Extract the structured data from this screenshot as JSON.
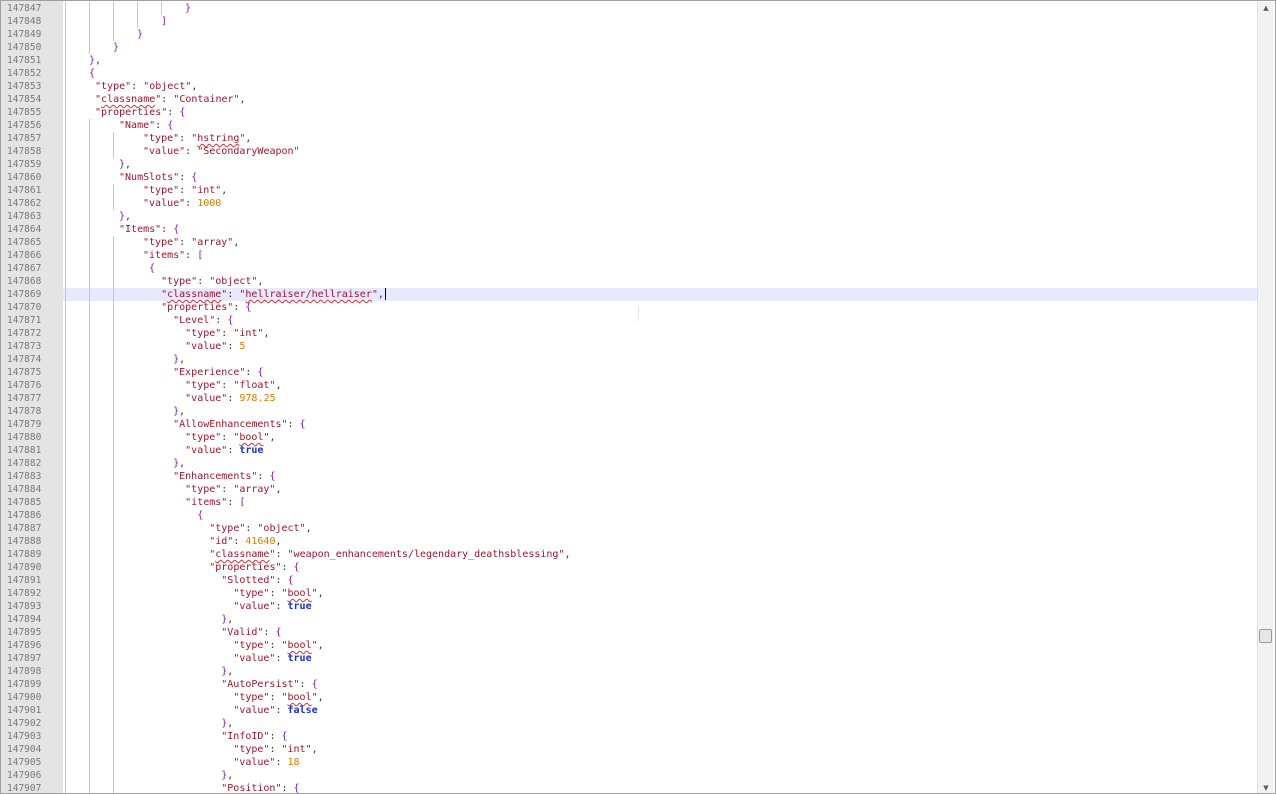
{
  "editor": {
    "caret_line": 147869,
    "lines": [
      {
        "n": "147847",
        "i": 5,
        "t": [
          [
            "}",
            "br"
          ]
        ]
      },
      {
        "n": "147848",
        "i": 4,
        "t": [
          [
            "]",
            "br"
          ]
        ]
      },
      {
        "n": "147849",
        "i": 3,
        "t": [
          [
            "}",
            "br"
          ]
        ]
      },
      {
        "n": "147850",
        "i": 2,
        "t": [
          [
            "}",
            "br"
          ]
        ]
      },
      {
        "n": "147851",
        "i": 1,
        "t": [
          [
            "}",
            "br"
          ],
          [
            ",",
            "p"
          ]
        ]
      },
      {
        "n": "147852",
        "i": 1,
        "t": [
          [
            "{",
            "br"
          ]
        ]
      },
      {
        "n": "147853",
        "i": 1,
        "x": 1,
        "t": [
          [
            "\"type\"",
            "key"
          ],
          [
            ": ",
            "p"
          ],
          [
            "\"object\"",
            "str"
          ],
          [
            ",",
            "p"
          ]
        ]
      },
      {
        "n": "147854",
        "i": 1,
        "x": 1,
        "t": [
          [
            "\"",
            "key"
          ],
          [
            "classname",
            "key",
            "sq"
          ],
          [
            "\"",
            "key"
          ],
          [
            ": ",
            "p"
          ],
          [
            "\"Container\"",
            "str"
          ],
          [
            ",",
            "p"
          ]
        ]
      },
      {
        "n": "147855",
        "i": 1,
        "x": 1,
        "t": [
          [
            "\"properties\"",
            "key"
          ],
          [
            ": ",
            "p"
          ],
          [
            "{",
            "br"
          ]
        ]
      },
      {
        "n": "147856",
        "i": 2,
        "x": 1,
        "t": [
          [
            "\"Name\"",
            "key"
          ],
          [
            ": ",
            "p"
          ],
          [
            "{",
            "br"
          ]
        ]
      },
      {
        "n": "147857",
        "i": 3,
        "x": 1,
        "t": [
          [
            "\"type\"",
            "key"
          ],
          [
            ": ",
            "p"
          ],
          [
            "\"",
            "str"
          ],
          [
            "hstring",
            "str",
            "sq"
          ],
          [
            "\"",
            "str"
          ],
          [
            ",",
            "p"
          ]
        ]
      },
      {
        "n": "147858",
        "i": 3,
        "x": 1,
        "t": [
          [
            "\"value\"",
            "key"
          ],
          [
            ": ",
            "p"
          ],
          [
            "\"SecondaryWeapon\"",
            "str"
          ]
        ]
      },
      {
        "n": "147859",
        "i": 2,
        "x": 1,
        "t": [
          [
            "}",
            "br"
          ],
          [
            ",",
            "p"
          ]
        ]
      },
      {
        "n": "147860",
        "i": 2,
        "x": 1,
        "t": [
          [
            "\"NumSlots\"",
            "key"
          ],
          [
            ": ",
            "p"
          ],
          [
            "{",
            "br"
          ]
        ]
      },
      {
        "n": "147861",
        "i": 3,
        "x": 1,
        "t": [
          [
            "\"type\"",
            "key"
          ],
          [
            ": ",
            "p"
          ],
          [
            "\"int\"",
            "str"
          ],
          [
            ",",
            "p"
          ]
        ]
      },
      {
        "n": "147862",
        "i": 3,
        "x": 1,
        "t": [
          [
            "\"value\"",
            "key"
          ],
          [
            ": ",
            "p"
          ],
          [
            "1000",
            "num"
          ]
        ]
      },
      {
        "n": "147863",
        "i": 2,
        "x": 1,
        "t": [
          [
            "}",
            "br"
          ],
          [
            ",",
            "p"
          ]
        ]
      },
      {
        "n": "147864",
        "i": 2,
        "x": 1,
        "t": [
          [
            "\"Items\"",
            "key"
          ],
          [
            ": ",
            "p"
          ],
          [
            "{",
            "br"
          ]
        ]
      },
      {
        "n": "147865",
        "i": 3,
        "x": 1,
        "t": [
          [
            "\"type\"",
            "key"
          ],
          [
            ": ",
            "p"
          ],
          [
            "\"array\"",
            "str"
          ],
          [
            ",",
            "p"
          ]
        ]
      },
      {
        "n": "147866",
        "i": 3,
        "x": 1,
        "t": [
          [
            "\"items\"",
            "key"
          ],
          [
            ": ",
            "p"
          ],
          [
            "[",
            "br"
          ]
        ]
      },
      {
        "n": "147867",
        "i": 3,
        "x": 2,
        "t": [
          [
            "{",
            "br"
          ]
        ]
      },
      {
        "n": "147868",
        "i": 3,
        "x": 4,
        "t": [
          [
            "\"type\"",
            "key"
          ],
          [
            ": ",
            "p"
          ],
          [
            "\"object\"",
            "str"
          ],
          [
            ",",
            "p"
          ]
        ]
      },
      {
        "n": "147869",
        "i": 3,
        "x": 4,
        "cur": true,
        "t": [
          [
            "\"",
            "key"
          ],
          [
            "classname",
            "key",
            "sq"
          ],
          [
            "\"",
            "key"
          ],
          [
            ": ",
            "p"
          ],
          [
            "\"",
            "str"
          ],
          [
            "hellraiser/hellraiser",
            "str",
            "sq"
          ],
          [
            "\"",
            "str"
          ],
          [
            ",",
            "p"
          ]
        ]
      },
      {
        "n": "147870",
        "i": 3,
        "x": 4,
        "t": [
          [
            "\"properties\"",
            "key"
          ],
          [
            ": ",
            "p"
          ],
          [
            "{",
            "br"
          ]
        ]
      },
      {
        "n": "147871",
        "i": 3,
        "x": 6,
        "t": [
          [
            "\"Level\"",
            "key"
          ],
          [
            ": ",
            "p"
          ],
          [
            "{",
            "br"
          ]
        ]
      },
      {
        "n": "147872",
        "i": 3,
        "x": 8,
        "t": [
          [
            "\"type\"",
            "key"
          ],
          [
            ": ",
            "p"
          ],
          [
            "\"int\"",
            "str"
          ],
          [
            ",",
            "p"
          ]
        ]
      },
      {
        "n": "147873",
        "i": 3,
        "x": 8,
        "t": [
          [
            "\"value\"",
            "key"
          ],
          [
            ": ",
            "p"
          ],
          [
            "5",
            "num"
          ]
        ]
      },
      {
        "n": "147874",
        "i": 3,
        "x": 6,
        "t": [
          [
            "}",
            "br"
          ],
          [
            ",",
            "p"
          ]
        ]
      },
      {
        "n": "147875",
        "i": 3,
        "x": 6,
        "t": [
          [
            "\"Experience\"",
            "key"
          ],
          [
            ": ",
            "p"
          ],
          [
            "{",
            "br"
          ]
        ]
      },
      {
        "n": "147876",
        "i": 3,
        "x": 8,
        "t": [
          [
            "\"type\"",
            "key"
          ],
          [
            ": ",
            "p"
          ],
          [
            "\"float\"",
            "str"
          ],
          [
            ",",
            "p"
          ]
        ]
      },
      {
        "n": "147877",
        "i": 3,
        "x": 8,
        "t": [
          [
            "\"value\"",
            "key"
          ],
          [
            ": ",
            "p"
          ],
          [
            "978.25",
            "num"
          ]
        ]
      },
      {
        "n": "147878",
        "i": 3,
        "x": 6,
        "t": [
          [
            "}",
            "br"
          ],
          [
            ",",
            "p"
          ]
        ]
      },
      {
        "n": "147879",
        "i": 3,
        "x": 6,
        "t": [
          [
            "\"AllowEnhancements\"",
            "key"
          ],
          [
            ": ",
            "p"
          ],
          [
            "{",
            "br"
          ]
        ]
      },
      {
        "n": "147880",
        "i": 3,
        "x": 8,
        "t": [
          [
            "\"type\"",
            "key"
          ],
          [
            ": ",
            "p"
          ],
          [
            "\"",
            "str"
          ],
          [
            "bool",
            "str",
            "sq"
          ],
          [
            "\"",
            "str"
          ],
          [
            ",",
            "p"
          ]
        ]
      },
      {
        "n": "147881",
        "i": 3,
        "x": 8,
        "t": [
          [
            "\"value\"",
            "key"
          ],
          [
            ": ",
            "p"
          ],
          [
            "true",
            "kw"
          ]
        ]
      },
      {
        "n": "147882",
        "i": 3,
        "x": 6,
        "t": [
          [
            "}",
            "br"
          ],
          [
            ",",
            "p"
          ]
        ]
      },
      {
        "n": "147883",
        "i": 3,
        "x": 6,
        "t": [
          [
            "\"Enhancements\"",
            "key"
          ],
          [
            ": ",
            "p"
          ],
          [
            "{",
            "br"
          ]
        ]
      },
      {
        "n": "147884",
        "i": 3,
        "x": 8,
        "t": [
          [
            "\"type\"",
            "key"
          ],
          [
            ": ",
            "p"
          ],
          [
            "\"array\"",
            "str"
          ],
          [
            ",",
            "p"
          ]
        ]
      },
      {
        "n": "147885",
        "i": 3,
        "x": 8,
        "t": [
          [
            "\"items\"",
            "key"
          ],
          [
            ": ",
            "p"
          ],
          [
            "[",
            "br"
          ]
        ]
      },
      {
        "n": "147886",
        "i": 3,
        "x": 10,
        "t": [
          [
            "{",
            "br"
          ]
        ]
      },
      {
        "n": "147887",
        "i": 3,
        "x": 12,
        "t": [
          [
            "\"type\"",
            "key"
          ],
          [
            ": ",
            "p"
          ],
          [
            "\"object\"",
            "str"
          ],
          [
            ",",
            "p"
          ]
        ]
      },
      {
        "n": "147888",
        "i": 3,
        "x": 12,
        "t": [
          [
            "\"id\"",
            "key"
          ],
          [
            ": ",
            "p"
          ],
          [
            "41640",
            "num"
          ],
          [
            ",",
            "p"
          ]
        ]
      },
      {
        "n": "147889",
        "i": 3,
        "x": 12,
        "t": [
          [
            "\"",
            "key"
          ],
          [
            "classname",
            "key",
            "sq"
          ],
          [
            "\"",
            "key"
          ],
          [
            ": ",
            "p"
          ],
          [
            "\"weapon_enhancements/legendary_deathsblessing\"",
            "str"
          ],
          [
            ",",
            "p"
          ]
        ]
      },
      {
        "n": "147890",
        "i": 3,
        "x": 12,
        "t": [
          [
            "\"properties\"",
            "key"
          ],
          [
            ": ",
            "p"
          ],
          [
            "{",
            "br"
          ]
        ]
      },
      {
        "n": "147891",
        "i": 3,
        "x": 14,
        "t": [
          [
            "\"Slotted\"",
            "key"
          ],
          [
            ": ",
            "p"
          ],
          [
            "{",
            "br"
          ]
        ]
      },
      {
        "n": "147892",
        "i": 3,
        "x": 16,
        "t": [
          [
            "\"type\"",
            "key"
          ],
          [
            ": ",
            "p"
          ],
          [
            "\"",
            "str"
          ],
          [
            "bool",
            "str",
            "sq"
          ],
          [
            "\"",
            "str"
          ],
          [
            ",",
            "p"
          ]
        ]
      },
      {
        "n": "147893",
        "i": 3,
        "x": 16,
        "t": [
          [
            "\"value\"",
            "key"
          ],
          [
            ": ",
            "p"
          ],
          [
            "true",
            "kw"
          ]
        ]
      },
      {
        "n": "147894",
        "i": 3,
        "x": 14,
        "t": [
          [
            "}",
            "br"
          ],
          [
            ",",
            "p"
          ]
        ]
      },
      {
        "n": "147895",
        "i": 3,
        "x": 14,
        "t": [
          [
            "\"Valid\"",
            "key"
          ],
          [
            ": ",
            "p"
          ],
          [
            "{",
            "br"
          ]
        ]
      },
      {
        "n": "147896",
        "i": 3,
        "x": 16,
        "t": [
          [
            "\"type\"",
            "key"
          ],
          [
            ": ",
            "p"
          ],
          [
            "\"",
            "str"
          ],
          [
            "bool",
            "str",
            "sq"
          ],
          [
            "\"",
            "str"
          ],
          [
            ",",
            "p"
          ]
        ]
      },
      {
        "n": "147897",
        "i": 3,
        "x": 16,
        "t": [
          [
            "\"value\"",
            "key"
          ],
          [
            ": ",
            "p"
          ],
          [
            "true",
            "kw"
          ]
        ]
      },
      {
        "n": "147898",
        "i": 3,
        "x": 14,
        "t": [
          [
            "}",
            "br"
          ],
          [
            ",",
            "p"
          ]
        ]
      },
      {
        "n": "147899",
        "i": 3,
        "x": 14,
        "t": [
          [
            "\"AutoPersist\"",
            "key"
          ],
          [
            ": ",
            "p"
          ],
          [
            "{",
            "br"
          ]
        ]
      },
      {
        "n": "147900",
        "i": 3,
        "x": 16,
        "t": [
          [
            "\"type\"",
            "key"
          ],
          [
            ": ",
            "p"
          ],
          [
            "\"",
            "str"
          ],
          [
            "bool",
            "str",
            "sq"
          ],
          [
            "\"",
            "str"
          ],
          [
            ",",
            "p"
          ]
        ]
      },
      {
        "n": "147901",
        "i": 3,
        "x": 16,
        "t": [
          [
            "\"value\"",
            "key"
          ],
          [
            ": ",
            "p"
          ],
          [
            "false",
            "kw"
          ]
        ]
      },
      {
        "n": "147902",
        "i": 3,
        "x": 14,
        "t": [
          [
            "}",
            "br"
          ],
          [
            ",",
            "p"
          ]
        ]
      },
      {
        "n": "147903",
        "i": 3,
        "x": 14,
        "t": [
          [
            "\"InfoID\"",
            "key"
          ],
          [
            ": ",
            "p"
          ],
          [
            "{",
            "br"
          ]
        ]
      },
      {
        "n": "147904",
        "i": 3,
        "x": 16,
        "t": [
          [
            "\"type\"",
            "key"
          ],
          [
            ": ",
            "p"
          ],
          [
            "\"int\"",
            "str"
          ],
          [
            ",",
            "p"
          ]
        ]
      },
      {
        "n": "147905",
        "i": 3,
        "x": 16,
        "t": [
          [
            "\"value\"",
            "key"
          ],
          [
            ": ",
            "p"
          ],
          [
            "18",
            "num"
          ]
        ]
      },
      {
        "n": "147906",
        "i": 3,
        "x": 14,
        "t": [
          [
            "}",
            "br"
          ],
          [
            ",",
            "p"
          ]
        ]
      },
      {
        "n": "147907",
        "i": 3,
        "x": 14,
        "t": [
          [
            "\"Position\"",
            "key"
          ],
          [
            ": ",
            "p"
          ],
          [
            "{",
            "br"
          ]
        ]
      }
    ]
  },
  "scrollbar": {
    "up_icon": "scroll-up-arrow-icon",
    "down_icon": "scroll-down-arrow-icon",
    "up_glyph": "▲",
    "down_glyph": "▼"
  },
  "colors": {
    "key": "#a0152b",
    "string": "#a0152b",
    "number": "#e07a00",
    "keyword": "#1a2fd0",
    "bracket": "#7e1fb2",
    "current_line": "#e8e8ff",
    "gutter": "#e4e4e4"
  }
}
